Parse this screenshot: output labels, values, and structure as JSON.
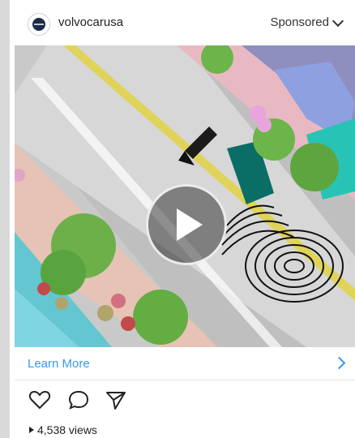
{
  "post": {
    "username": "volvocarusa",
    "sponsored_label": "Sponsored",
    "cta_label": "Learn More",
    "views": "4,538 views"
  },
  "icons": {
    "avatar": "volvo-logo-icon",
    "sponsored_menu": "chevron-down-icon",
    "play": "play-icon",
    "cta": "chevron-right-icon",
    "like": "heart-icon",
    "comment": "comment-icon",
    "share": "send-icon",
    "views": "triangle-play-icon"
  },
  "colors": {
    "accent": "#3897f0",
    "text": "#222222"
  }
}
